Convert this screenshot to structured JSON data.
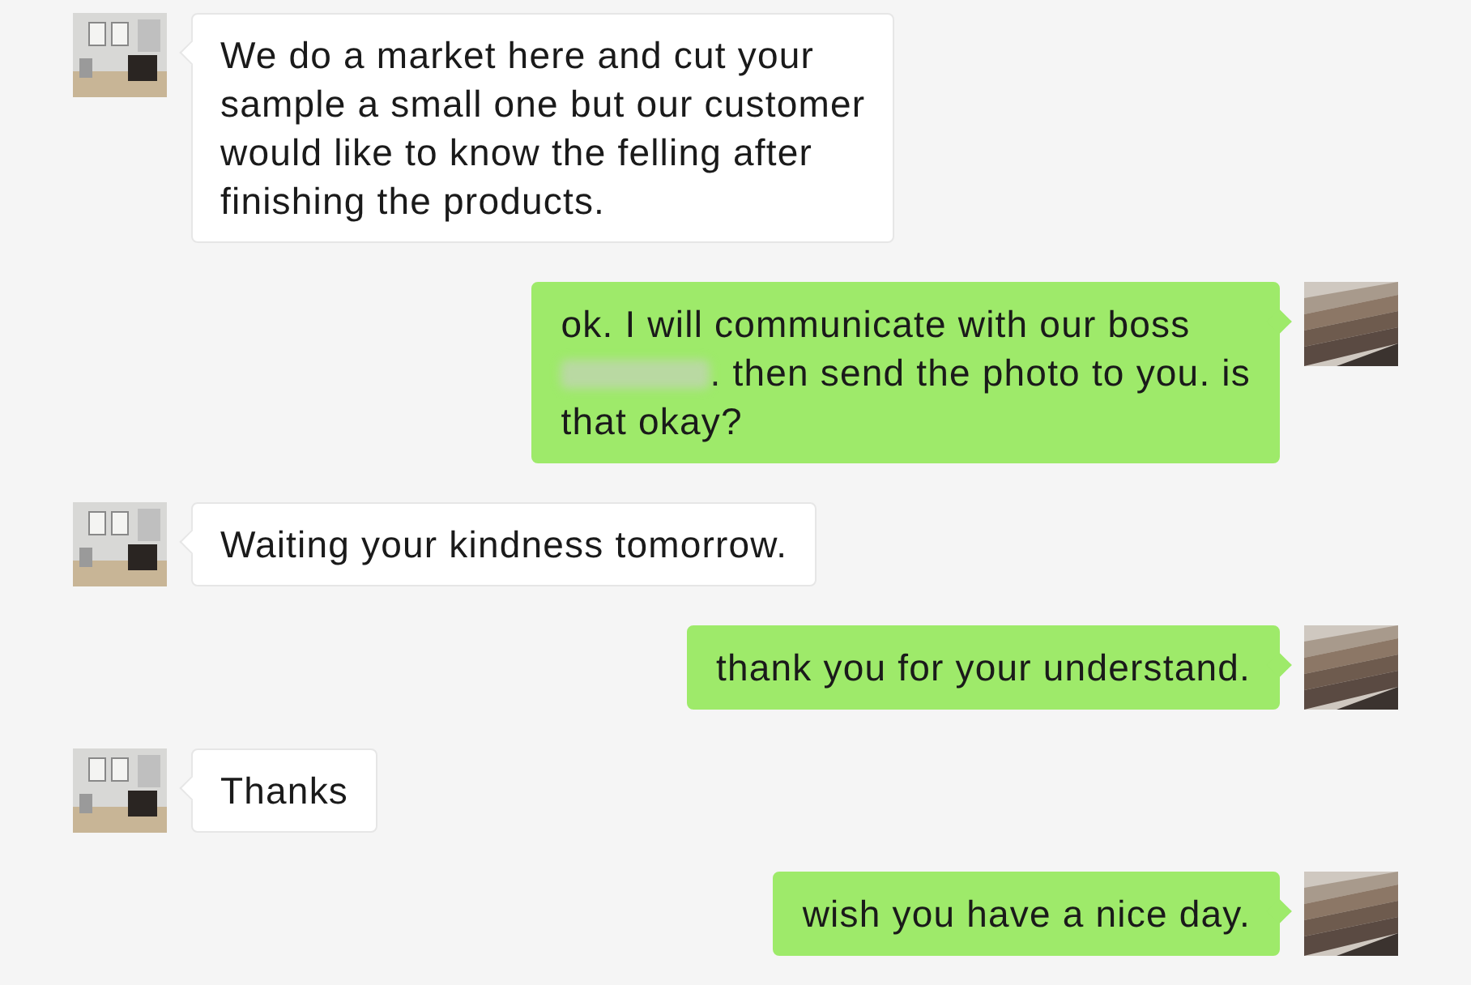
{
  "messages": [
    {
      "outgoing": false,
      "lines": [
        [
          {
            "kind": "text",
            "text": "We do a market here and cut your"
          }
        ],
        [
          {
            "kind": "text",
            "text": "sample a small one but our customer"
          }
        ],
        [
          {
            "kind": "text",
            "text": "would like to know the felling after"
          }
        ],
        [
          {
            "kind": "text",
            "text": "finishing the products."
          }
        ]
      ]
    },
    {
      "outgoing": true,
      "lines": [
        [
          {
            "kind": "text",
            "text": "ok. I will communicate with our boss"
          }
        ],
        [
          {
            "kind": "redacted"
          },
          {
            "kind": "text",
            "text": ". then send the photo to you. is"
          }
        ],
        [
          {
            "kind": "text",
            "text": "that okay?"
          }
        ]
      ]
    },
    {
      "outgoing": false,
      "lines": [
        [
          {
            "kind": "text",
            "text": "Waiting your kindness tomorrow."
          }
        ]
      ]
    },
    {
      "outgoing": true,
      "lines": [
        [
          {
            "kind": "text",
            "text": "thank you for your understand."
          }
        ]
      ]
    },
    {
      "outgoing": false,
      "lines": [
        [
          {
            "kind": "text",
            "text": "Thanks"
          }
        ]
      ]
    },
    {
      "outgoing": true,
      "lines": [
        [
          {
            "kind": "text",
            "text": "wish you have a nice day."
          }
        ]
      ]
    }
  ]
}
